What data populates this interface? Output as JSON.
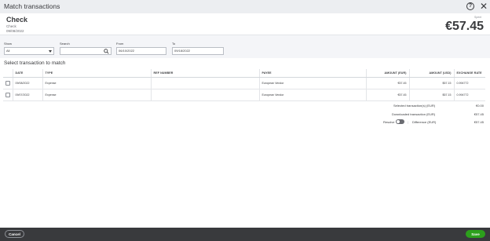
{
  "dialog": {
    "title": "Match transactions"
  },
  "header": {
    "type": "Check",
    "subtitle": "Check",
    "date": "09/08/2022",
    "spent_label": "Spent",
    "amount": "€57.45"
  },
  "filters": {
    "show_label": "Show",
    "show_value": "All",
    "search_label": "Search",
    "search_value": "",
    "from_label": "From",
    "from_value": "06/10/2022",
    "to_label": "To",
    "to_value": "09/18/2022"
  },
  "section_title": "Select transaction to match",
  "table": {
    "columns": [
      "DATE",
      "TYPE",
      "REF NUMBER",
      "PAYEE",
      "AMOUNT (EUR)",
      "AMOUNT (USD)",
      "EXCHANGE RATE"
    ],
    "rows": [
      [
        "09/08/2022",
        "Expense",
        "",
        "European Vendor",
        "€57.45",
        "$57.15",
        "0.994772"
      ],
      [
        "09/07/2022",
        "Expense",
        "",
        "European Vendor",
        "€57.45",
        "$57.15",
        "0.994772"
      ]
    ]
  },
  "summary": {
    "selected_label": "Selected transaction(s) (EUR)",
    "selected_value": "€0.00",
    "downloaded_label": "Downloaded transaction (EUR)",
    "downloaded_value": "€57.45",
    "resolve_label": "Resolve",
    "difference_label": "Difference (EUR)",
    "difference_value": "€57.45",
    "resolve_on": false
  },
  "footer": {
    "cancel_label": "Cancel",
    "save_label": "Save"
  },
  "colors": {
    "save_button": "#2ca01c",
    "footer_bar": "#393a3d",
    "titlebar": "#eceef1",
    "filter_bar": "#f4f5f8"
  },
  "icons": [
    "help-icon",
    "close-icon",
    "search-icon",
    "chevron-down-icon",
    "checkbox-icon"
  ]
}
